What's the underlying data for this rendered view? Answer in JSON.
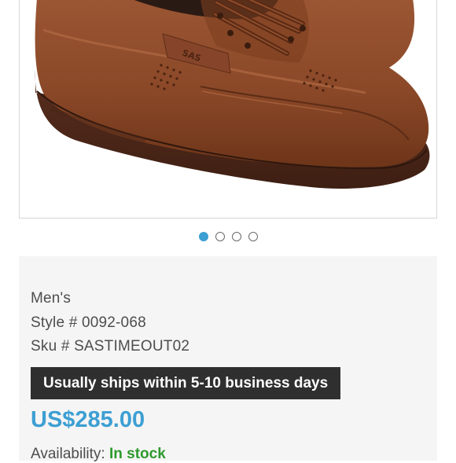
{
  "carousel": {
    "total_slides": 4,
    "active_index": 0
  },
  "product": {
    "gender": "Men's",
    "style": "Style # 0092-068",
    "sku": "Sku # SASTIMEOUT02",
    "shipping_notice": "Usually ships within 5-10 business days",
    "price": "US$285.00",
    "availability_label": "Availability:",
    "availability_value": "In stock",
    "brand_emboss": "SAS"
  },
  "colors": {
    "price": "#3d9fd3",
    "in_stock": "#2e9a2e",
    "badge_bg": "#2f2f2f",
    "active_dot": "#3d9fd3",
    "shoe_leather": "#8a4a2a"
  }
}
